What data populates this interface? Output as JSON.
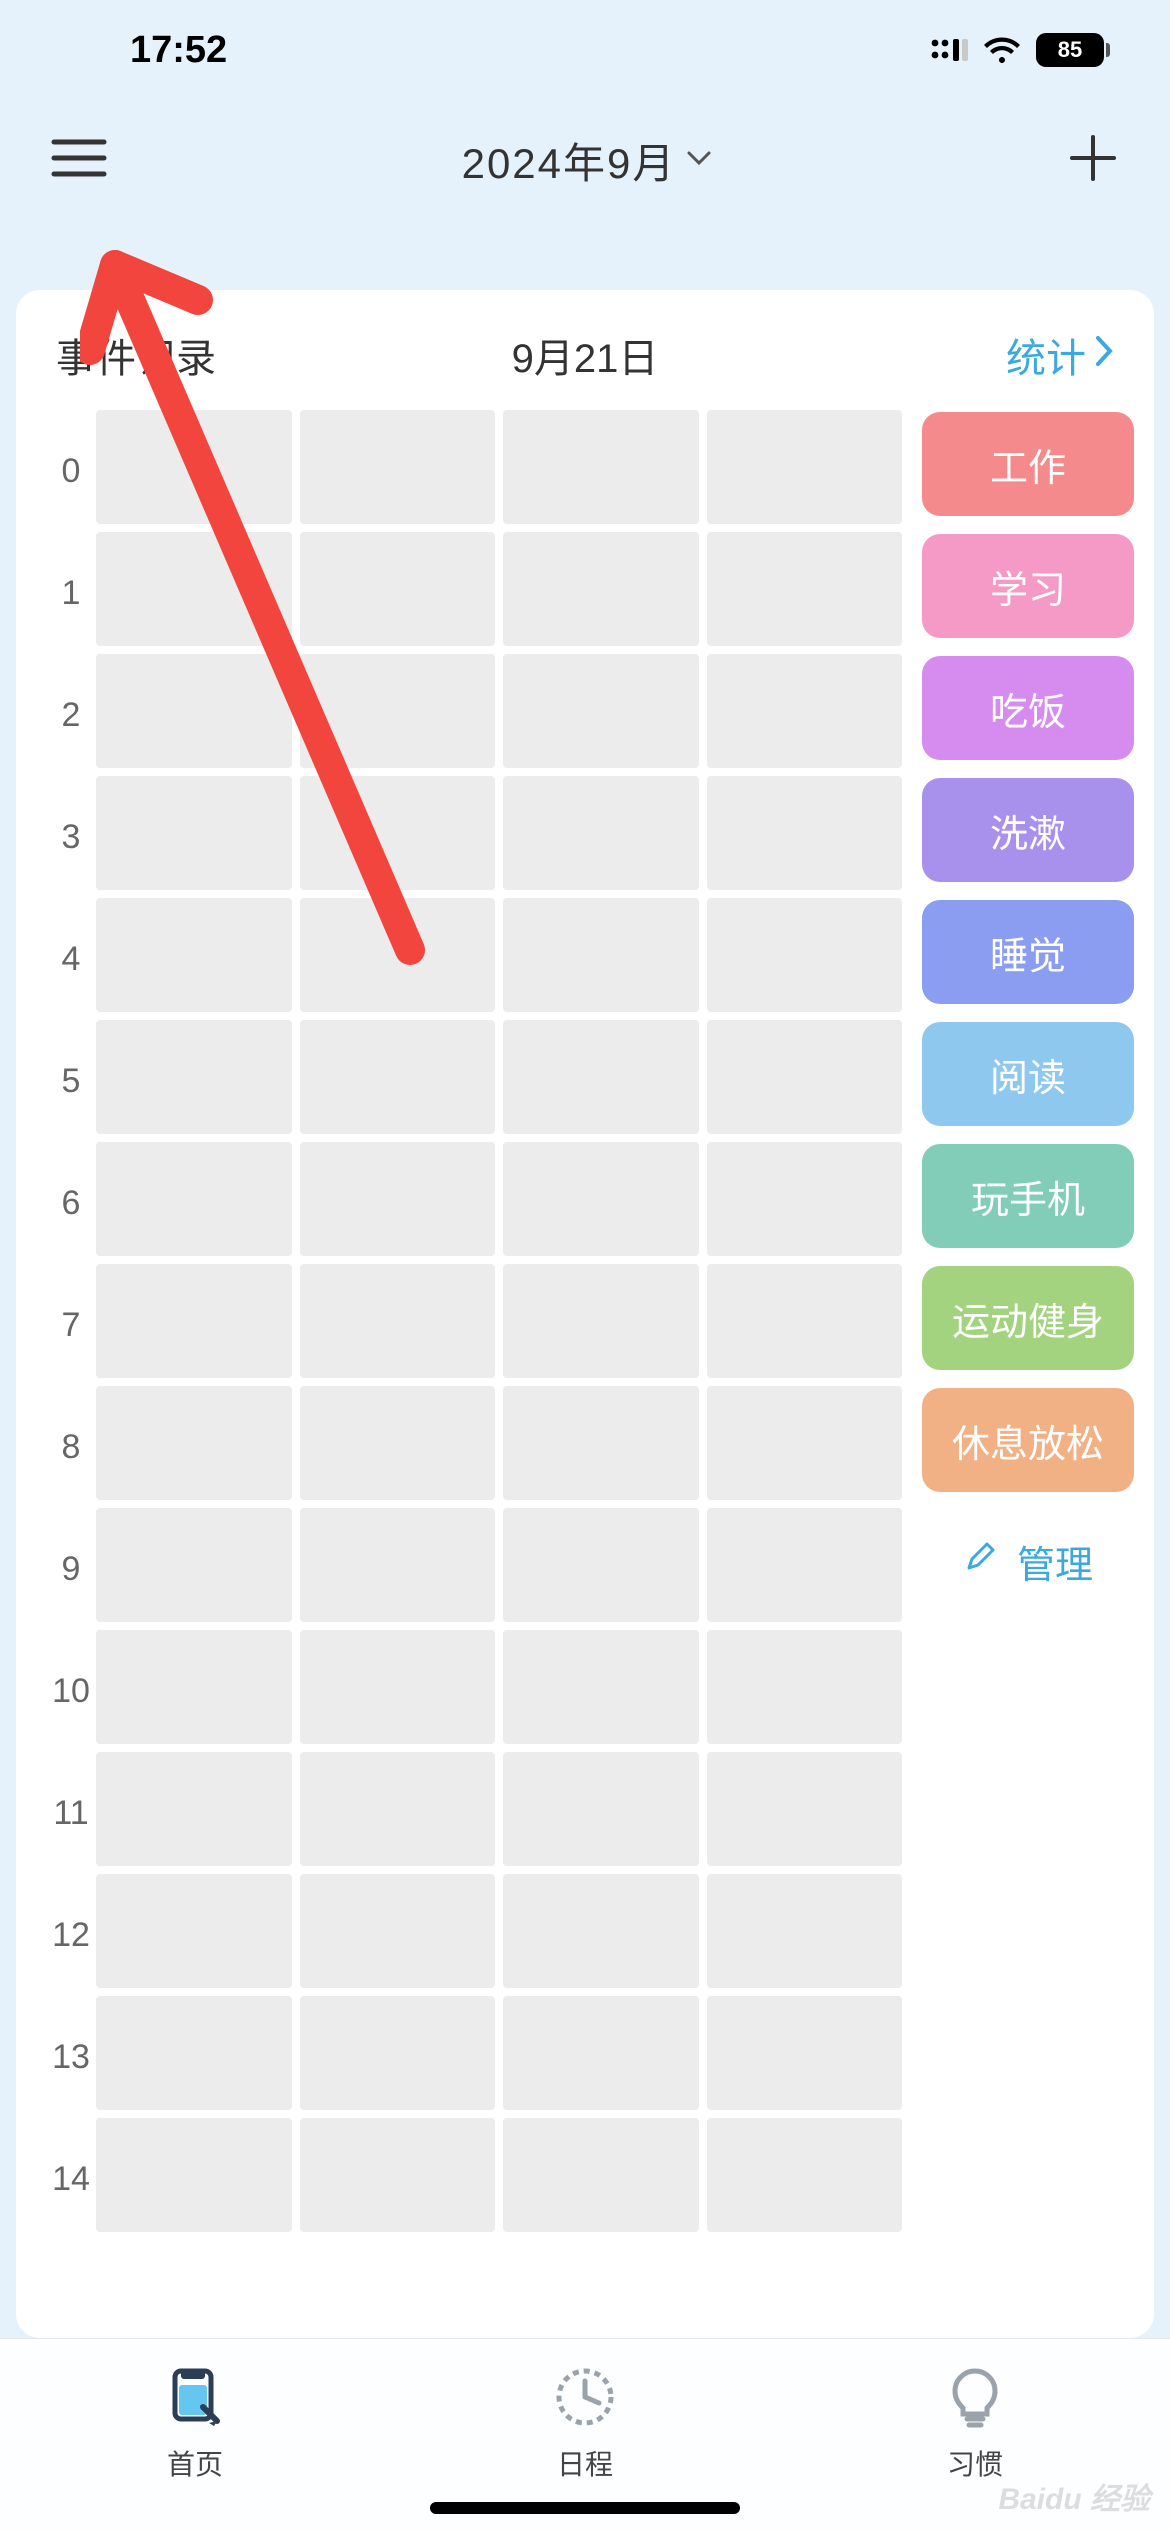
{
  "status": {
    "time": "17:52",
    "battery": "85"
  },
  "nav": {
    "title": "2024年9月"
  },
  "card": {
    "left": "事件记录",
    "date": "9月21日",
    "stats": "统计"
  },
  "hours": [
    "0",
    "1",
    "2",
    "3",
    "4",
    "5",
    "6",
    "7",
    "8",
    "9",
    "10",
    "11",
    "12",
    "13",
    "14"
  ],
  "categories": [
    {
      "label": "工作",
      "bg": "#f48a8c"
    },
    {
      "label": "学习",
      "bg": "#f59ac6"
    },
    {
      "label": "吃饭",
      "bg": "#d68cef"
    },
    {
      "label": "洗漱",
      "bg": "#a891ed"
    },
    {
      "label": "睡觉",
      "bg": "#8a9df0"
    },
    {
      "label": "阅读",
      "bg": "#8fc8ee"
    },
    {
      "label": "玩手机",
      "bg": "#82cdb7"
    },
    {
      "label": "运动健身",
      "bg": "#a3d37f"
    },
    {
      "label": "休息放松",
      "bg": "#f2b185"
    }
  ],
  "manage": "管理",
  "tabs": {
    "home": "首页",
    "schedule": "日程",
    "habit": "习惯"
  },
  "watermark": "Baidu 经验"
}
